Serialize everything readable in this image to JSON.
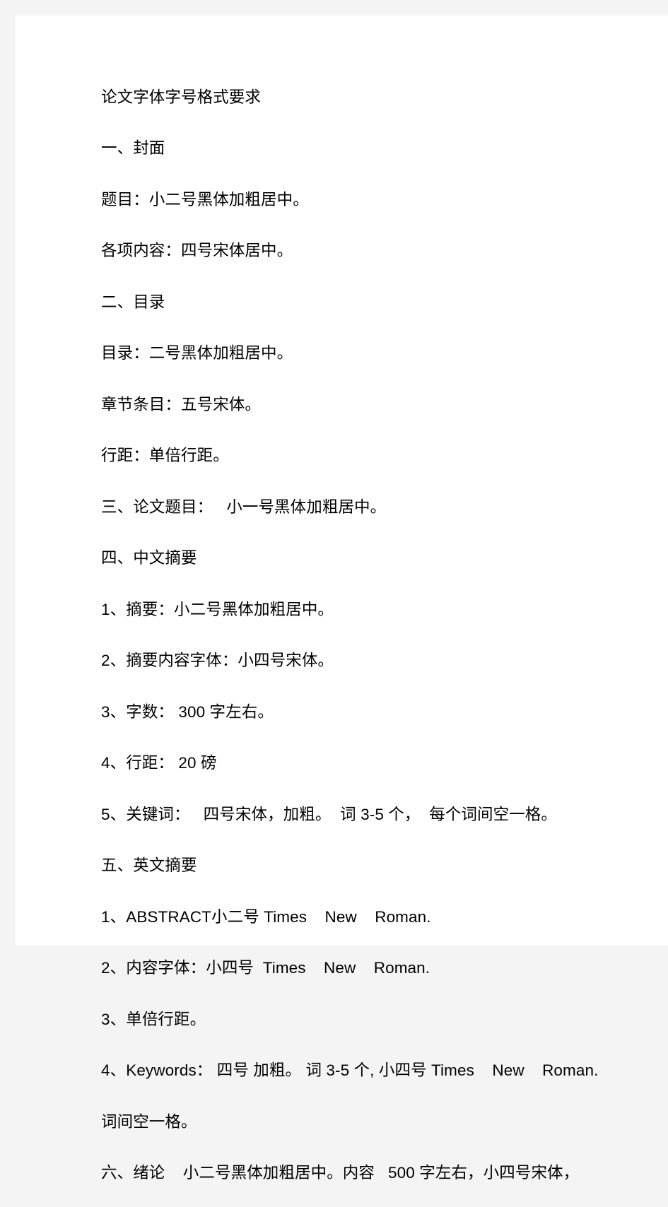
{
  "document": {
    "title": "论文字体字号格式要求",
    "page_background": "#ffffff",
    "gutter_color": "#f4f4f4",
    "text_color": "#000000",
    "lines": [
      {
        "id": "title",
        "text": "论文字体字号格式要求"
      },
      {
        "id": "section-1-heading",
        "text": "一、封面"
      },
      {
        "id": "cover-title",
        "text": "题目：小二号黑体加粗居中。"
      },
      {
        "id": "cover-items",
        "text": "各项内容：四号宋体居中。"
      },
      {
        "id": "section-2-heading",
        "text": "二、目录"
      },
      {
        "id": "toc-heading-style",
        "text": "目录：二号黑体加粗居中。"
      },
      {
        "id": "toc-entry-style",
        "text": "章节条目：五号宋体。"
      },
      {
        "id": "toc-line-spacing",
        "text": "行距：单倍行距。"
      },
      {
        "id": "section-3-paper-title",
        "text": "三、论文题目：   小一号黑体加粗居中。"
      },
      {
        "id": "section-4-heading",
        "text": "四、中文摘要"
      },
      {
        "id": "cn-abstract-1",
        "text": "1、摘要：小二号黑体加粗居中。"
      },
      {
        "id": "cn-abstract-2",
        "text": "2、摘要内容字体：小四号宋体。"
      },
      {
        "id": "cn-abstract-3",
        "text": "3、字数： 300 字左右。"
      },
      {
        "id": "cn-abstract-4",
        "text": "4、行距： 20 磅"
      },
      {
        "id": "cn-abstract-5",
        "text": "5、关键词：   四号宋体，加粗。  词 3-5 个，  每个词间空一格。"
      },
      {
        "id": "section-5-heading",
        "text": "五、英文摘要"
      },
      {
        "id": "en-abstract-1",
        "text": "1、ABSTRACT小二号 Times    New    Roman."
      },
      {
        "id": "en-abstract-2",
        "text": "2、内容字体：小四号  Times    New    Roman."
      },
      {
        "id": "en-abstract-3",
        "text": "3、单倍行距。"
      },
      {
        "id": "en-abstract-4",
        "text": "4、Keywords： 四号 加粗。 词 3-5 个, 小四号 Times    New    Roman."
      },
      {
        "id": "en-abstract-4-cont",
        "text": "词间空一格。"
      },
      {
        "id": "section-6-intro",
        "text": "六、绪论    小二号黑体加粗居中。内容   500 字左右，小四号宋体，"
      }
    ]
  }
}
